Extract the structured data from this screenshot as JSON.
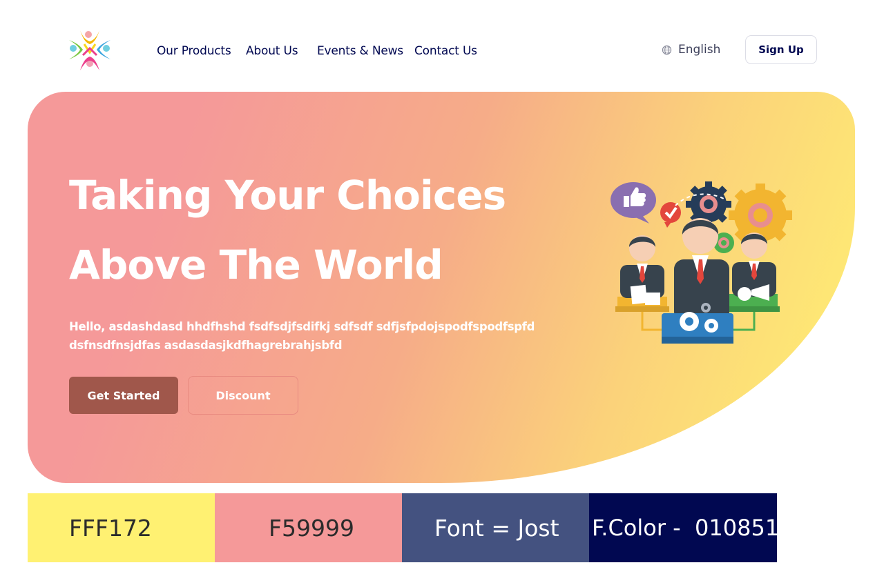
{
  "header": {
    "logo_icon": "people-circle-logo",
    "nav": [
      {
        "label": "Our Products"
      },
      {
        "label": "About Us"
      },
      {
        "label": "Events & News"
      },
      {
        "label": "Contact Us"
      }
    ],
    "language": {
      "icon": "globe-icon",
      "label": "English"
    },
    "signup_label": "Sign Up"
  },
  "hero": {
    "title_line1": "Taking Your Choices",
    "title_line2": "Above The World",
    "text": "Hello, asdashdasd hhdfhshd fsdfsdjfsdifkj sdfsdf sdfjsfpdojspodfspodfspfd dsfnsdfnsjdfas asdasdasjkdfhagrebrahjsbfd",
    "primary_button": "Get Started",
    "secondary_button": "Discount",
    "illustration_icon": "business-team-illustration",
    "gradient_colors": [
      "#F59999",
      "#FFF172"
    ]
  },
  "swatches": [
    {
      "label": "FFF172",
      "color": "#FFF172"
    },
    {
      "label": "F59999",
      "color": "#F59999"
    },
    {
      "label": "Font = Jost",
      "color": "#445280"
    },
    {
      "label": "F.Color -  010851",
      "color": "#010851"
    }
  ],
  "colors": {
    "text": "#010851",
    "button_primary": "#a0574b"
  }
}
